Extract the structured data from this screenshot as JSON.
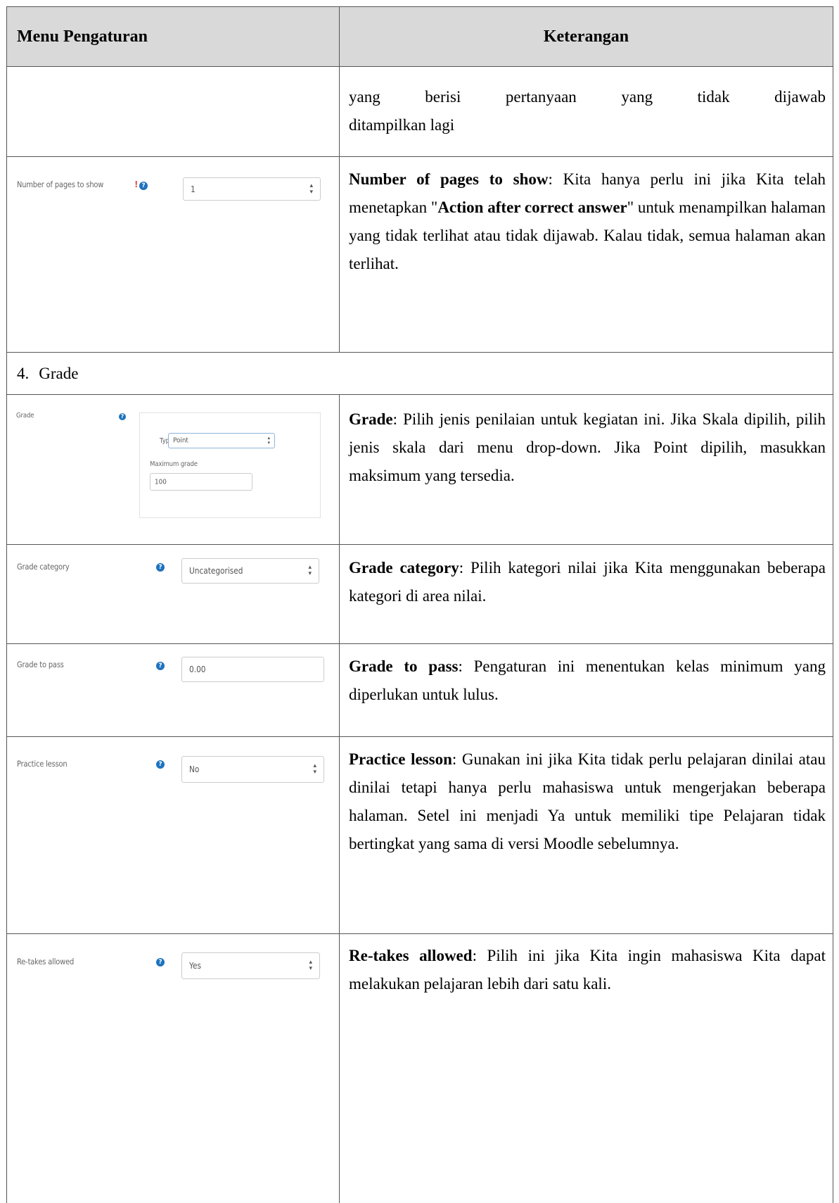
{
  "header": {
    "col1": "Menu Pengaturan",
    "col2": "Keterangan"
  },
  "row_cont": {
    "line1": "yang berisi pertanyaan yang tidak dijawab",
    "line2": "ditampilkan lagi"
  },
  "row_pages": {
    "ui_label": "Number of pages to show",
    "ui_excl": "!",
    "ui_value": "1",
    "bold1": "Number of pages to show",
    "t1": ": Kita hanya perlu ini jika Kita telah menetapkan \"",
    "bold2": "Action after correct answer",
    "t2": "\" untuk menampilkan halaman yang tidak terlihat atau tidak dijawab. Kalau tidak, semua halaman akan terlihat."
  },
  "section": {
    "number": "4.",
    "title": "Grade"
  },
  "row_grade": {
    "ui_label": "Grade",
    "type_label": "Type",
    "type_value": "Point",
    "max_label": "Maximum grade",
    "max_value": "100",
    "bold": "Grade",
    "text": ": Pilih jenis penilaian untuk kegiatan ini. Jika Skala dipilih, pilih jenis skala dari menu drop-down. Jika Point dipilih, masukkan maksimum yang tersedia."
  },
  "row_category": {
    "ui_label": "Grade category",
    "ui_value": "Uncategorised",
    "bold": "Grade category",
    "text": ": Pilih kategori nilai jika Kita menggunakan beberapa kategori di area nilai."
  },
  "row_pass": {
    "ui_label": "Grade to pass",
    "ui_value": "0.00",
    "bold": "Grade to pass",
    "text": ": Pengaturan ini menentukan kelas minimum yang diperlukan untuk lulus."
  },
  "row_practice": {
    "ui_label": "Practice lesson",
    "ui_value": "No",
    "bold": "Practice lesson",
    "text": ": Gunakan ini jika Kita tidak perlu pelajaran dinilai atau dinilai tetapi hanya perlu mahasiswa untuk mengerjakan beberapa halaman. Setel ini menjadi Ya untuk memiliki tipe Pelajaran tidak bertingkat yang sama di versi Moodle sebelumnya."
  },
  "row_retakes": {
    "ui_label": "Re-takes allowed",
    "ui_value": "Yes",
    "bold": "Re-takes allowed",
    "text": ": Pilih ini jika Kita ingin mahasiswa Kita dapat melakukan pelajaran lebih dari satu kali."
  },
  "icons": {
    "help": "question-circle-icon",
    "caret": "up-down-caret-icon",
    "warning": "exclamation-icon"
  },
  "colors": {
    "header_bg": "#d9d9d9",
    "help_icon": "#1e73be",
    "warning": "#d9534f"
  }
}
